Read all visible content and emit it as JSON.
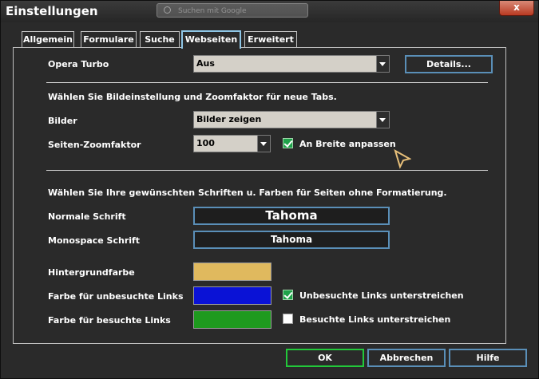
{
  "window": {
    "title": "Einstellungen",
    "search_placeholder": "Suchen mit Google",
    "close_label": "x"
  },
  "tabs": [
    {
      "label": "Allgemein",
      "active": false
    },
    {
      "label": "Formulare",
      "active": false
    },
    {
      "label": "Suche",
      "active": false
    },
    {
      "label": "Webseiten",
      "active": true
    },
    {
      "label": "Erweitert",
      "active": false
    }
  ],
  "turbo": {
    "label": "Opera Turbo",
    "value": "Aus",
    "details_button": "Details..."
  },
  "images": {
    "heading": "Wählen Sie Bildeinstellung und Zoomfaktor für neue Tabs.",
    "images_label": "Bilder",
    "images_value": "Bilder zeigen",
    "zoom_label": "Seiten-Zoomfaktor",
    "zoom_value": "100",
    "fit_width_label": "An Breite anpassen",
    "fit_width_checked": true
  },
  "fonts": {
    "heading": "Wählen Sie Ihre gewünschten Schriften u. Farben für Seiten ohne Formatierung.",
    "normal_label": "Normale Schrift",
    "normal_value": "Tahoma",
    "mono_label": "Monospace Schrift",
    "mono_value": "Tahoma"
  },
  "colors": {
    "background_label": "Hintergrundfarbe",
    "background_color": "#e0b95e",
    "unvisited_label": "Farbe für unbesuchte Links",
    "unvisited_color": "#0a12d6",
    "unvisited_underline_label": "Unbesuchte Links unterstreichen",
    "unvisited_underline_checked": true,
    "visited_label": "Farbe für besuchte Links",
    "visited_color": "#1e9a1e",
    "visited_underline_label": "Besuchte Links unterstreichen",
    "visited_underline_checked": false
  },
  "footer": {
    "ok": "OK",
    "cancel": "Abbrechen",
    "help": "Hilfe"
  }
}
